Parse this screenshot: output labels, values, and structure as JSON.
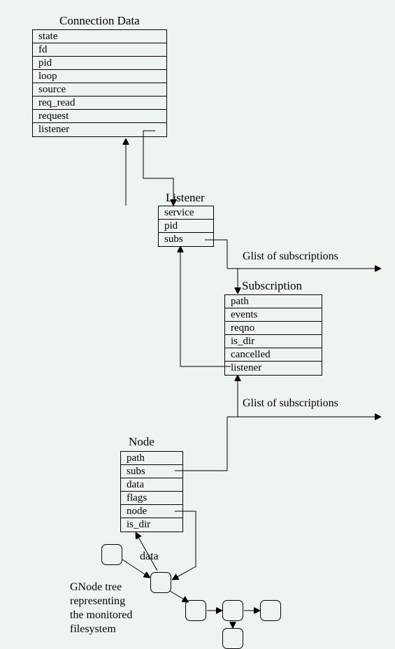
{
  "connection_data": {
    "title": "Connection Data",
    "fields": [
      "state",
      "fd",
      "pid",
      "loop",
      "source",
      "req_read",
      "request",
      "listener"
    ]
  },
  "listener": {
    "title": "Listener",
    "fields": [
      "service",
      "pid",
      "subs"
    ]
  },
  "subscription": {
    "title": "Subscription",
    "fields": [
      "path",
      "events",
      "reqno",
      "is_dir",
      "cancelled",
      "listener"
    ]
  },
  "node": {
    "title": "Node",
    "fields": [
      "path",
      "subs",
      "data",
      "flags",
      "node",
      "is_dir"
    ]
  },
  "annotations": {
    "glist1": "Glist of subscriptions",
    "glist2": "Glist of subscriptions",
    "data_label": "data",
    "tree_caption": "GNode tree\nrepresenting\nthe monitored\nfilesystem"
  }
}
